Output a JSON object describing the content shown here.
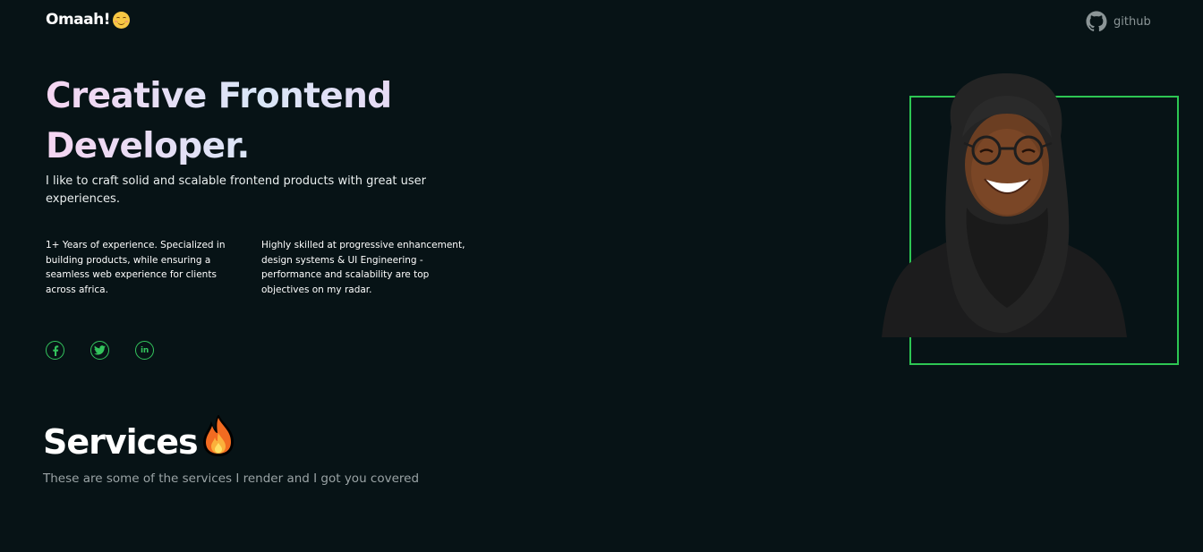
{
  "header": {
    "logo_text": "Omaah!",
    "logo_emoji_icon": "smiling-face-icon",
    "github_label": "github"
  },
  "hero": {
    "title_line1": "Creative Frontend",
    "title_line2": "Developer.",
    "subtitle": "I like to craft solid and scalable frontend products with great user experiences.",
    "column1": "1+ Years of experience. Specialized in building products, while ensuring a seamless web experience for clients across africa.",
    "column2": "Highly skilled at progressive enhancement, design systems & UI Engineering - performance and scalability are top objectives on my radar."
  },
  "socials": [
    {
      "icon": "facebook-icon"
    },
    {
      "icon": "twitter-icon"
    },
    {
      "icon": "linkedin-icon"
    }
  ],
  "services": {
    "title": "Services",
    "emoji_icon": "fire-icon",
    "subtitle": "These are some of the services I render and I got you covered"
  },
  "colors": {
    "background": "#071316",
    "accent_green": "#2dc653",
    "muted_text": "#9aa3a5"
  }
}
